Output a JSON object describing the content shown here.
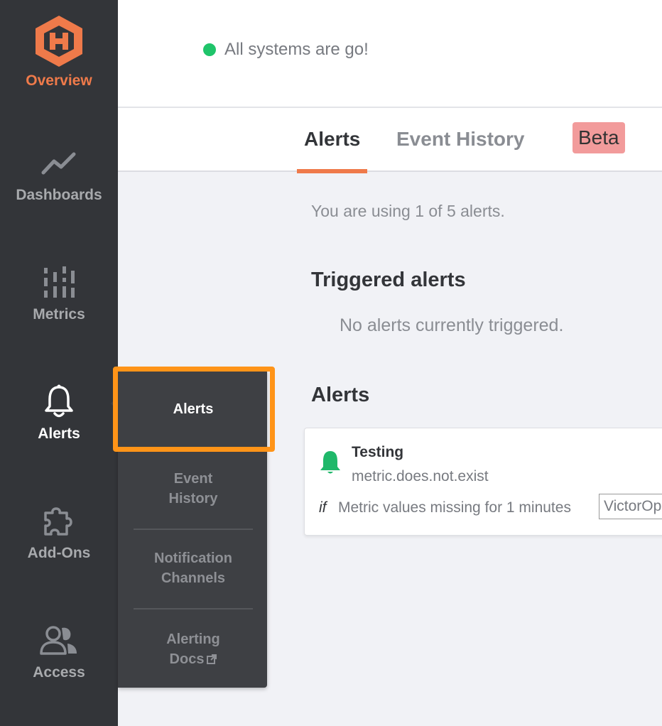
{
  "sidebar": {
    "items": [
      {
        "label": "Overview",
        "icon": "logo-icon"
      },
      {
        "label": "Dashboards",
        "icon": "chart-line-icon"
      },
      {
        "label": "Metrics",
        "icon": "metrics-bars-icon"
      },
      {
        "label": "Alerts",
        "icon": "bell-icon"
      },
      {
        "label": "Add-Ons",
        "icon": "puzzle-icon"
      },
      {
        "label": "Access",
        "icon": "users-icon"
      }
    ]
  },
  "header": {
    "status_text": "All systems are go!",
    "status_color": "#1fc46a"
  },
  "tabs": [
    {
      "label": "Alerts"
    },
    {
      "label": "Event History"
    }
  ],
  "beta_label": "Beta",
  "main": {
    "usage_text": "You are using 1 of 5 alerts.",
    "triggered_heading": "Triggered alerts",
    "triggered_empty": "No alerts currently triggered.",
    "alerts_heading": "Alerts",
    "alerts": [
      {
        "name": "Testing",
        "metric": "metric.does.not.exist",
        "if_label": "if",
        "condition": "Metric values missing for 1 minutes",
        "channel": "VictorOps"
      }
    ]
  },
  "submenu": {
    "items": [
      {
        "label": "Alerts"
      },
      {
        "label": "Event\nHistory"
      },
      {
        "label": "Notification\nChannels"
      },
      {
        "label": "Alerting\nDocs"
      }
    ]
  },
  "colors": {
    "accent": "#ef7a4a",
    "sidebar_bg": "#333539",
    "highlight": "#ff9418",
    "alert_bell": "#1fb86a"
  }
}
